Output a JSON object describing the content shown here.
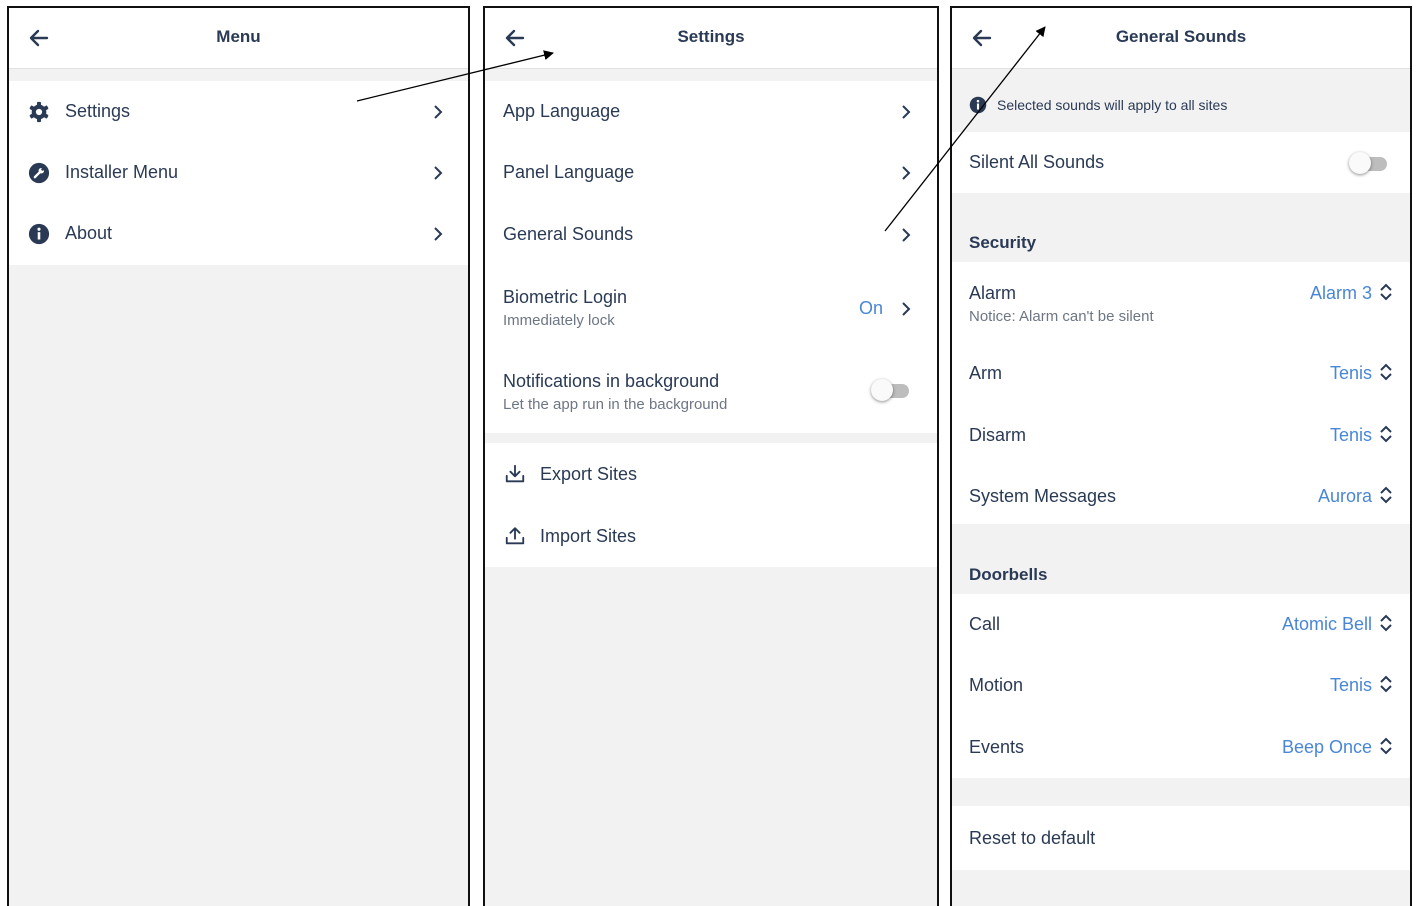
{
  "colors": {
    "accent": "#4a86d6",
    "text": "#2a3a55",
    "muted": "#6d7684",
    "background": "#f2f2f2"
  },
  "menu": {
    "title": "Menu",
    "items": [
      {
        "label": "Settings",
        "icon": "gear-icon"
      },
      {
        "label": "Installer Menu",
        "icon": "wrench-icon"
      },
      {
        "label": "About",
        "icon": "info-icon"
      }
    ]
  },
  "settings": {
    "title": "Settings",
    "app_language": "App Language",
    "panel_language": "Panel Language",
    "general_sounds": "General Sounds",
    "biometric": {
      "label": "Biometric Login",
      "sub": "Immediately lock",
      "value": "On"
    },
    "notifications": {
      "label": "Notifications in background",
      "sub": "Let the app run in the background",
      "enabled": false
    },
    "export_sites": "Export Sites",
    "import_sites": "Import Sites"
  },
  "sounds": {
    "title": "General Sounds",
    "notice": "Selected sounds will apply to all sites",
    "silent_all": {
      "label": "Silent All Sounds",
      "enabled": false
    },
    "security": {
      "header": "Security",
      "alarm": {
        "label": "Alarm",
        "sub": "Notice: Alarm can't be silent",
        "value": "Alarm 3"
      },
      "arm": {
        "label": "Arm",
        "value": "Tenis"
      },
      "disarm": {
        "label": "Disarm",
        "value": "Tenis"
      },
      "system_messages": {
        "label": "System Messages",
        "value": "Aurora"
      }
    },
    "doorbells": {
      "header": "Doorbells",
      "call": {
        "label": "Call",
        "value": "Atomic Bell"
      },
      "motion": {
        "label": "Motion",
        "value": "Tenis"
      },
      "events": {
        "label": "Events",
        "value": "Beep Once"
      }
    },
    "reset": "Reset to default"
  }
}
